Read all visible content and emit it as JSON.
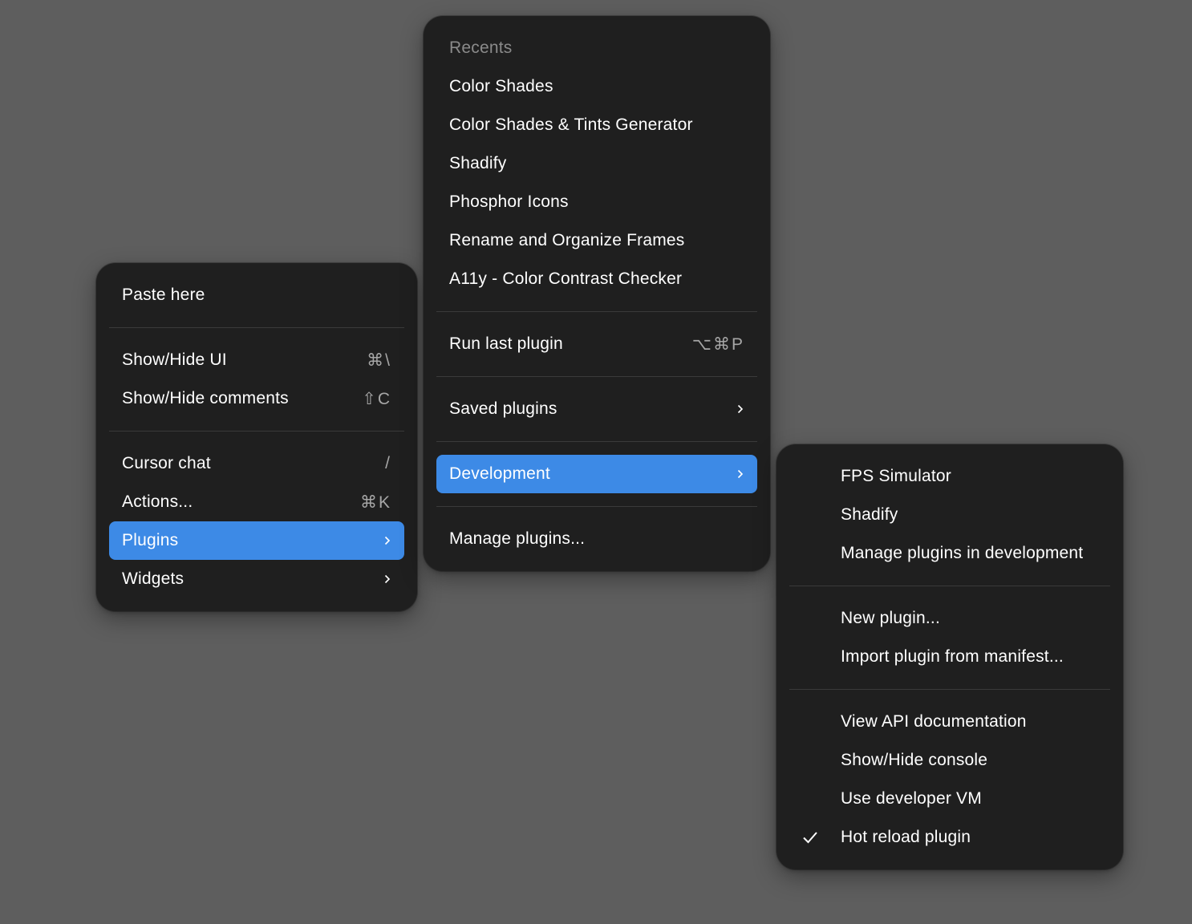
{
  "context_menu": {
    "items": [
      {
        "label": "Paste here"
      },
      {
        "label": "Show/Hide UI",
        "shortcut": "⌘\\"
      },
      {
        "label": "Show/Hide comments",
        "shortcut": "⇧C"
      },
      {
        "label": "Cursor chat",
        "shortcut": "/"
      },
      {
        "label": "Actions...",
        "shortcut": "⌘K"
      },
      {
        "label": "Plugins"
      },
      {
        "label": "Widgets"
      }
    ]
  },
  "plugins_menu": {
    "recents_header": "Recents",
    "recents": [
      "Color Shades",
      "Color Shades & Tints Generator",
      "Shadify",
      "Phosphor Icons",
      "Rename and Organize Frames",
      "A11y - Color Contrast Checker"
    ],
    "run_last": {
      "label": "Run last plugin",
      "shortcut": "⌥⌘P"
    },
    "saved": {
      "label": "Saved plugins"
    },
    "development": {
      "label": "Development"
    },
    "manage": {
      "label": "Manage plugins..."
    }
  },
  "development_menu": {
    "group1": [
      "FPS Simulator",
      "Shadify",
      "Manage plugins in development"
    ],
    "group2": [
      "New plugin...",
      "Import plugin from manifest..."
    ],
    "group3": [
      "View API documentation",
      "Show/Hide console",
      "Use developer VM",
      "Hot reload plugin"
    ]
  },
  "colors": {
    "background": "#5e5e5e",
    "menu": "#1f1f1f",
    "highlight": "#3d8ae6",
    "separator": "#3a3a3a",
    "muted_text": "#8a8a8a"
  },
  "icons": {
    "submenu": "chevron-right-icon",
    "checked": "checkmark-icon"
  }
}
